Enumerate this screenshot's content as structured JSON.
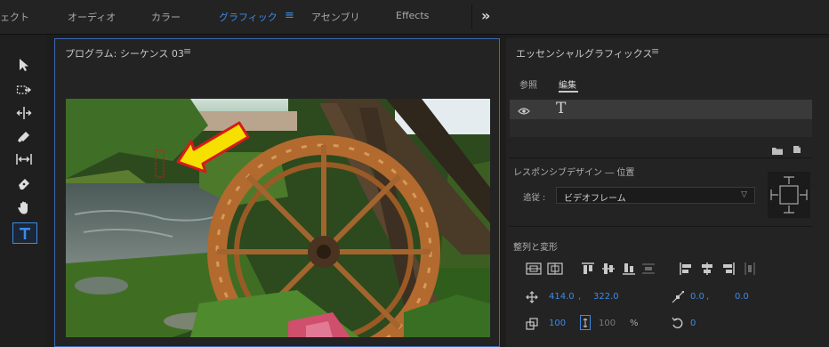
{
  "workspaces": {
    "effects_partial": "ェクト",
    "audio": "オーディオ",
    "color": "カラー",
    "graphics": "グラフィック",
    "graphics_menu_icon": "≡",
    "assembly": "アセンブリ",
    "effects": "Effects",
    "more_icon": "»"
  },
  "program_monitor": {
    "title": "プログラム: シーケンス 03",
    "menu_icon": "≡"
  },
  "essential_graphics": {
    "title": "エッセンシャルグラフィックス",
    "menu_icon": "≡",
    "tabs": {
      "browse": "参照",
      "edit": "編集"
    },
    "layer": {
      "eye_icon": "eye-icon",
      "type_glyph": "T"
    },
    "responsive": {
      "title": "レスポンシブデザイン ― 位置",
      "follow_label": "追従 :",
      "follow_value": "ビデオフレーム"
    },
    "align": {
      "title": "整列と変形",
      "position_x": "414.0",
      "position_y": "322.0",
      "anchor_x": "0.0",
      "anchor_y": "0.0",
      "comma1": ",",
      "comma2": ",",
      "scale": "100",
      "scale_locked": "100",
      "percent": "%",
      "rotation": "0"
    }
  },
  "colors": {
    "accent": "#3c8be6",
    "arrow_fill": "#f5e000",
    "arrow_stroke": "#d61a1a"
  }
}
